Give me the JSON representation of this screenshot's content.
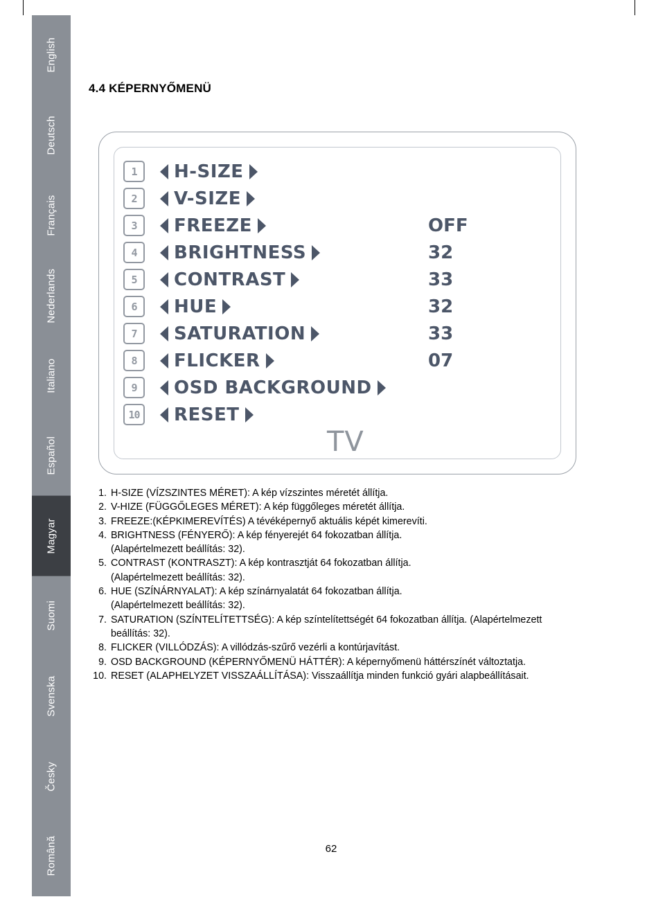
{
  "crop_marks": true,
  "sidebar": {
    "active": "Magyar",
    "items": [
      {
        "label": "English"
      },
      {
        "label": "Deutsch"
      },
      {
        "label": "Français"
      },
      {
        "label": "Nederlands"
      },
      {
        "label": "Italiano"
      },
      {
        "label": "Español"
      },
      {
        "label": "Magyar"
      },
      {
        "label": "Suomi"
      },
      {
        "label": "Svenska"
      },
      {
        "label": "Česky"
      },
      {
        "label": "Română"
      }
    ]
  },
  "section": {
    "title": "4.4 KÉPERNYŐMENÜ"
  },
  "osd": {
    "tv_label": "TV",
    "rows": [
      {
        "num": "1",
        "label": "H-SIZE",
        "value": "",
        "left_arrow": true,
        "right_arrow": true
      },
      {
        "num": "2",
        "label": "V-SIZE",
        "value": "",
        "left_arrow": true,
        "right_arrow": true
      },
      {
        "num": "3",
        "label": "FREEZE",
        "value": "OFF",
        "left_arrow": true,
        "right_arrow": true
      },
      {
        "num": "4",
        "label": "BRIGHTNESS",
        "value": "32",
        "left_arrow": true,
        "right_arrow": true
      },
      {
        "num": "5",
        "label": "CONTRAST",
        "value": "33",
        "left_arrow": true,
        "right_arrow": true
      },
      {
        "num": "6",
        "label": "HUE",
        "value": "32",
        "left_arrow": true,
        "right_arrow": true
      },
      {
        "num": "7",
        "label": "SATURATION",
        "value": "33",
        "left_arrow": true,
        "right_arrow": true
      },
      {
        "num": "8",
        "label": "FLICKER",
        "value": "07",
        "left_arrow": true,
        "right_arrow": true
      },
      {
        "num": "9",
        "label": "OSD BACKGROUND",
        "value": "",
        "left_arrow": true,
        "right_arrow": true
      },
      {
        "num": "10",
        "label": "RESET",
        "value": "",
        "left_arrow": true,
        "right_arrow": true
      }
    ]
  },
  "descriptions": [
    {
      "num": "1.",
      "text": "H-SIZE (VÍZSZINTES MÉRET): A kép vízszintes méretét állítja.",
      "sub": ""
    },
    {
      "num": "2.",
      "text": "V-HIZE (FÜGGŐLEGES MÉRET): A kép függőleges méretét állítja.",
      "sub": ""
    },
    {
      "num": "3.",
      "text": "FREEZE:(KÉPKIMEREVÍTÉS) A tévéképernyő aktuális képét kimerevíti.",
      "sub": ""
    },
    {
      "num": "4.",
      "text": "BRIGHTNESS (FÉNYERŐ): A kép fényerejét 64 fokozatban állítja.",
      "sub": "(Alapértelmezett beállítás: 32)."
    },
    {
      "num": "5.",
      "text": "CONTRAST (KONTRASZT): A kép kontrasztját 64 fokozatban állítja.",
      "sub": "(Alapértelmezett beállítás: 32)."
    },
    {
      "num": "6.",
      "text": "HUE (SZÍNÁRNYALAT): A kép színárnyalatát 64 fokozatban állítja.",
      "sub": "(Alapértelmezett beállítás: 32)."
    },
    {
      "num": "7.",
      "text": "SATURATION (SZÍNTELÍTETTSÉG): A kép színtelítettségét 64 fokozatban állítja. (Alapértelmezett beállítás: 32).",
      "sub": ""
    },
    {
      "num": "8.",
      "text": "FLICKER (VILLÓDZÁS): A villódzás-szűrő vezérli a kontúrjavítást.",
      "sub": ""
    },
    {
      "num": "9.",
      "text": "OSD BACKGROUND (KÉPERNYŐMENÜ HÁTTÉR): A képernyőmenü háttérszínét változtatja.",
      "sub": ""
    },
    {
      "num": "10.",
      "text": "RESET (ALAPHELYZET VISSZAÁLLÍTÁSA): Visszaállítja minden funkció gyári alapbeállításait.",
      "sub": ""
    }
  ],
  "footer": {
    "page_number": "62"
  }
}
